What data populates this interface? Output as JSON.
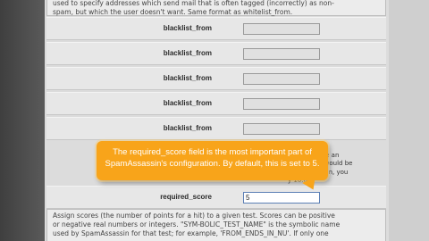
{
  "description_top": {
    "line1": "used to specify addresses which send mail that is often tagged (incorrectly) as non-",
    "line2": "spam, but which the user doesn't want. Same format as whitelist_from."
  },
  "fields": [
    {
      "label": "blacklist_from",
      "value": ""
    },
    {
      "label": "blacklist_from",
      "value": ""
    },
    {
      "label": "blacklist_from",
      "value": ""
    },
    {
      "label": "blacklist_from",
      "value": ""
    },
    {
      "label": "blacklist_from",
      "value": ""
    }
  ],
  "required_score": {
    "label": "required_score",
    "value": "5"
  },
  "required_score_description": {
    "line1": "'n.nn\" can be an",
    "line2": "gressive; it would be",
    "line3": "SpamAssassin, you",
    "line4": "y 10.0"
  },
  "tooltip": {
    "line1": "The required_score field is the most important part of",
    "line2": "SpamAssassin's configuration. By default, this is set to 5."
  },
  "description_bottom": {
    "line1": "Assign scores (the number of points for a hit) to a given test. Scores can be positive",
    "line2": "or negative real numbers or integers. \"SYM-BOLIC_TEST_NAME\" is the symbolic name",
    "line3": "used by SpamAssassin for that test; for example, 'FROM_ENDS_IN_NU'. If only one"
  },
  "colors": {
    "tooltip": "#f8a41a",
    "panel": "#e7e7e7",
    "active_input_border": "#5b7fb5"
  }
}
